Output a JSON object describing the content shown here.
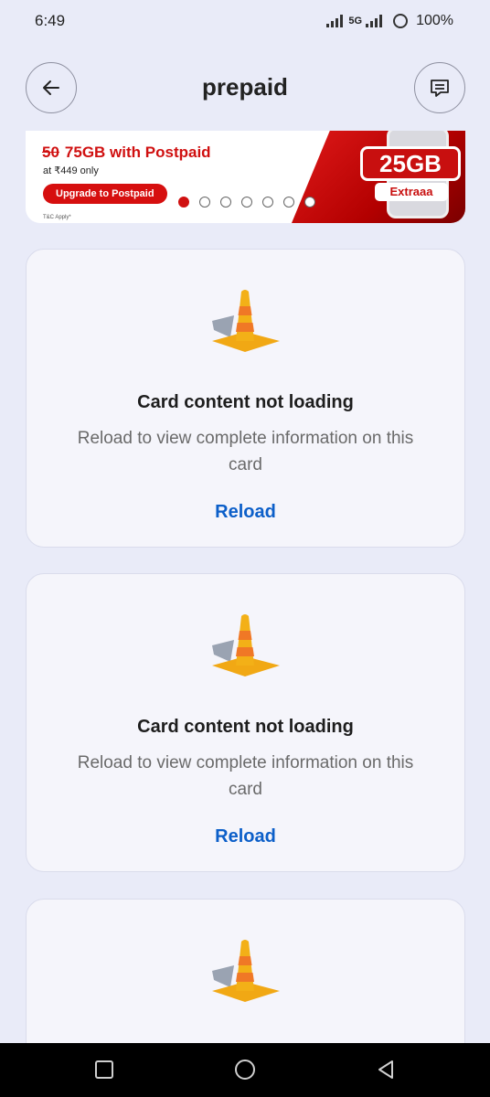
{
  "status_bar": {
    "time": "6:49",
    "network": "5G",
    "battery": "100%"
  },
  "header": {
    "title": "prepaid",
    "back_icon": "arrow-left-icon",
    "chat_icon": "chat-bubble-icon"
  },
  "banner": {
    "old_value": "50",
    "headline": "75GB with Postpaid",
    "subtext": "at ₹449 only",
    "cta": "Upgrade to Postpaid",
    "terms": "T&C Apply*",
    "badge_main": "25GB",
    "badge_sub": "Extraaa",
    "slides": 7,
    "active_slide": 1
  },
  "cards": [
    {
      "title": "Card content not loading",
      "message": "Reload to view complete information on this card",
      "action": "Reload"
    },
    {
      "title": "Card content not loading",
      "message": "Reload to view complete information on this card",
      "action": "Reload"
    },
    {
      "title": "",
      "message": "",
      "action": ""
    }
  ],
  "colors": {
    "accent_blue": "#0c5fc9",
    "brand_red": "#d01010",
    "background": "#e9ebf8"
  }
}
